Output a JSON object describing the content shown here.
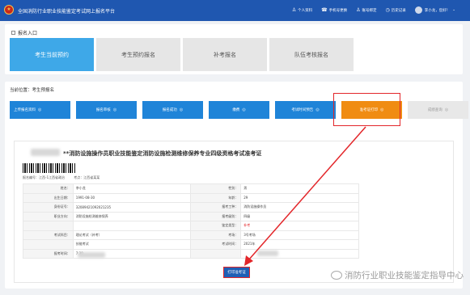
{
  "header": {
    "title": "全国消防行业职业技能鉴定考试网上报名平台",
    "nav": [
      {
        "icon": "user-icon",
        "glyph": "♙",
        "label": "个人资料"
      },
      {
        "icon": "phone-icon",
        "glyph": "☎",
        "label": "手机号更换"
      },
      {
        "icon": "shield-user-icon",
        "glyph": "♙",
        "label": "账号绑定"
      },
      {
        "icon": "clock-icon",
        "glyph": "◷",
        "label": "历史记录"
      }
    ],
    "user_name": "李小龙，您好！",
    "user_chevron": "⌄"
  },
  "entry": {
    "heading": "报名入口",
    "tabs": [
      {
        "label": "考生当前预约",
        "active": true
      },
      {
        "label": "考生预约报名",
        "active": false
      },
      {
        "label": "补考报名",
        "active": false
      },
      {
        "label": "队伍考核报名",
        "active": false
      }
    ]
  },
  "breadcrumb": "当前位置：考生预报名",
  "steps": [
    {
      "label": "上传报名资料",
      "state": "done"
    },
    {
      "label": "报名审核",
      "state": "done"
    },
    {
      "label": "报名成功",
      "state": "done"
    },
    {
      "label": "缴费",
      "state": "done"
    },
    {
      "label": "考试时间预告",
      "state": "done"
    },
    {
      "label": "准考证打印",
      "state": "current"
    },
    {
      "label": "成绩查询",
      "state": "pending"
    }
  ],
  "admit_card": {
    "title": "**消防设施操作员职业技能鉴定消防设施检测维修保养专业四级资格考试准考证",
    "meta": [
      "报名编号：江西-1江西省政治",
      "考点：江西省某某"
    ],
    "rows": [
      [
        "姓名：",
        "李小龙",
        "性别：",
        "男"
      ],
      [
        "出生日期：",
        "1991-08-30",
        "年龄：",
        "29"
      ],
      [
        "身份证号：",
        "32089421092021235",
        "报考工种：",
        "消防设施操作员"
      ],
      [
        "职业方向：",
        "消防设施检测维修保养",
        "报考级别：",
        "四级"
      ],
      [
        "",
        "",
        "鉴定类型：",
        "补考"
      ],
      [
        "考试科目：",
        "理论考试（补考）",
        "考场：",
        "3号考场"
      ],
      [
        "",
        "技能考试",
        "考试时间：",
        "2021年"
      ],
      [
        "报考时间：",
        "7:30",
        "",
        ""
      ]
    ],
    "print_button": "打印准考证"
  },
  "watermark": "消防行业职业技能鉴定指导中心",
  "colors": {
    "header": "#1f57b0",
    "tab_active": "#3ea8e8",
    "step_done": "#1f84d8",
    "step_current": "#f08c12",
    "annotation_red": "#e3262a"
  }
}
